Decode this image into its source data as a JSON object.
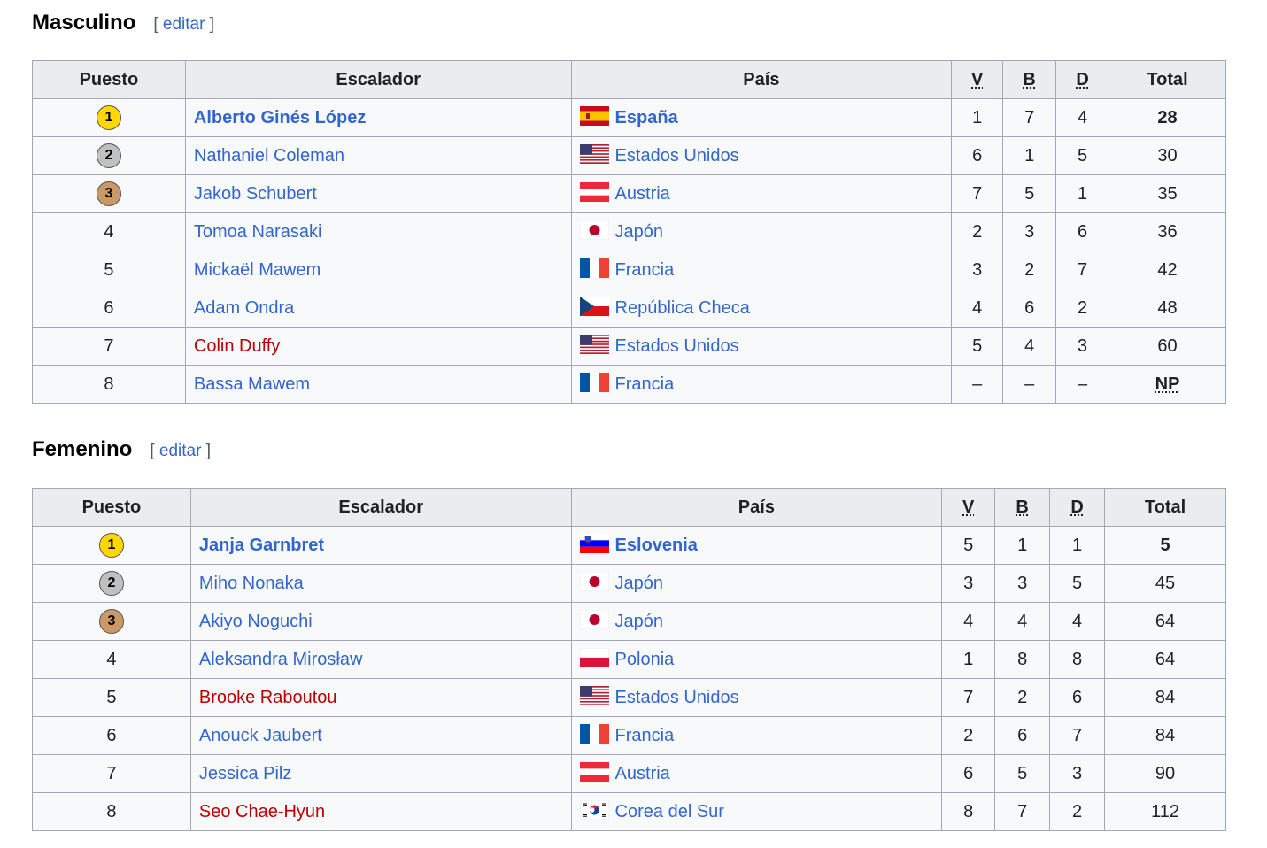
{
  "edit_label": "editar",
  "sections": [
    {
      "title": "Masculino",
      "headers": {
        "rank": "Puesto",
        "climber": "Escalador",
        "country": "País",
        "v": "V",
        "b": "B",
        "d": "D",
        "total": "Total"
      },
      "rows": [
        {
          "rank": "1",
          "medal": "gold",
          "climber": "Alberto Ginés López",
          "country": "España",
          "flag": "spain",
          "v": "1",
          "b": "7",
          "d": "4",
          "total": "28",
          "bold": true,
          "red": false
        },
        {
          "rank": "2",
          "medal": "silver",
          "climber": "Nathaniel Coleman",
          "country": "Estados Unidos",
          "flag": "usa",
          "v": "6",
          "b": "1",
          "d": "5",
          "total": "30",
          "bold": false,
          "red": false
        },
        {
          "rank": "3",
          "medal": "bronze",
          "climber": "Jakob Schubert",
          "country": "Austria",
          "flag": "austria",
          "v": "7",
          "b": "5",
          "d": "1",
          "total": "35",
          "bold": false,
          "red": false
        },
        {
          "rank": "4",
          "medal": "",
          "climber": "Tomoa Narasaki",
          "country": "Japón",
          "flag": "japan",
          "v": "2",
          "b": "3",
          "d": "6",
          "total": "36",
          "bold": false,
          "red": false
        },
        {
          "rank": "5",
          "medal": "",
          "climber": "Mickaël Mawem",
          "country": "Francia",
          "flag": "france",
          "v": "3",
          "b": "2",
          "d": "7",
          "total": "42",
          "bold": false,
          "red": false
        },
        {
          "rank": "6",
          "medal": "",
          "climber": "Adam Ondra",
          "country": "República Checa",
          "flag": "czech",
          "v": "4",
          "b": "6",
          "d": "2",
          "total": "48",
          "bold": false,
          "red": false
        },
        {
          "rank": "7",
          "medal": "",
          "climber": "Colin Duffy",
          "country": "Estados Unidos",
          "flag": "usa",
          "v": "5",
          "b": "4",
          "d": "3",
          "total": "60",
          "bold": false,
          "red": true
        },
        {
          "rank": "8",
          "medal": "",
          "climber": "Bassa Mawem",
          "country": "Francia",
          "flag": "france",
          "v": "–",
          "b": "–",
          "d": "–",
          "total": "NP",
          "bold": false,
          "red": false,
          "np": true
        }
      ]
    },
    {
      "title": "Femenino",
      "headers": {
        "rank": "Puesto",
        "climber": "Escalador",
        "country": "País",
        "v": "V",
        "b": "B",
        "d": "D",
        "total": "Total"
      },
      "rows": [
        {
          "rank": "1",
          "medal": "gold",
          "climber": "Janja Garnbret",
          "country": "Eslovenia",
          "flag": "slovenia",
          "v": "5",
          "b": "1",
          "d": "1",
          "total": "5",
          "bold": true,
          "red": false
        },
        {
          "rank": "2",
          "medal": "silver",
          "climber": "Miho Nonaka",
          "country": "Japón",
          "flag": "japan",
          "v": "3",
          "b": "3",
          "d": "5",
          "total": "45",
          "bold": false,
          "red": false
        },
        {
          "rank": "3",
          "medal": "bronze",
          "climber": "Akiyo Noguchi",
          "country": "Japón",
          "flag": "japan",
          "v": "4",
          "b": "4",
          "d": "4",
          "total": "64",
          "bold": false,
          "red": false
        },
        {
          "rank": "4",
          "medal": "",
          "climber": "Aleksandra Mirosław",
          "country": "Polonia",
          "flag": "poland",
          "v": "1",
          "b": "8",
          "d": "8",
          "total": "64",
          "bold": false,
          "red": false
        },
        {
          "rank": "5",
          "medal": "",
          "climber": "Brooke Raboutou",
          "country": "Estados Unidos",
          "flag": "usa",
          "v": "7",
          "b": "2",
          "d": "6",
          "total": "84",
          "bold": false,
          "red": true
        },
        {
          "rank": "6",
          "medal": "",
          "climber": "Anouck Jaubert",
          "country": "Francia",
          "flag": "france",
          "v": "2",
          "b": "6",
          "d": "7",
          "total": "84",
          "bold": false,
          "red": false
        },
        {
          "rank": "7",
          "medal": "",
          "climber": "Jessica Pilz",
          "country": "Austria",
          "flag": "austria",
          "v": "6",
          "b": "5",
          "d": "3",
          "total": "90",
          "bold": false,
          "red": false
        },
        {
          "rank": "8",
          "medal": "",
          "climber": "Seo Chae-Hyun",
          "country": "Corea del Sur",
          "flag": "korea",
          "v": "8",
          "b": "7",
          "d": "2",
          "total": "112",
          "bold": false,
          "red": true
        }
      ]
    }
  ],
  "colors": {
    "link": "#3366cc",
    "redlink": "#ba0000",
    "header_bg": "#eaecf0",
    "cell_bg": "#f8f9fa",
    "border": "#a2a9b1",
    "gold": "#ffd700",
    "silver": "#c0c0c0",
    "bronze": "#cc9966"
  }
}
